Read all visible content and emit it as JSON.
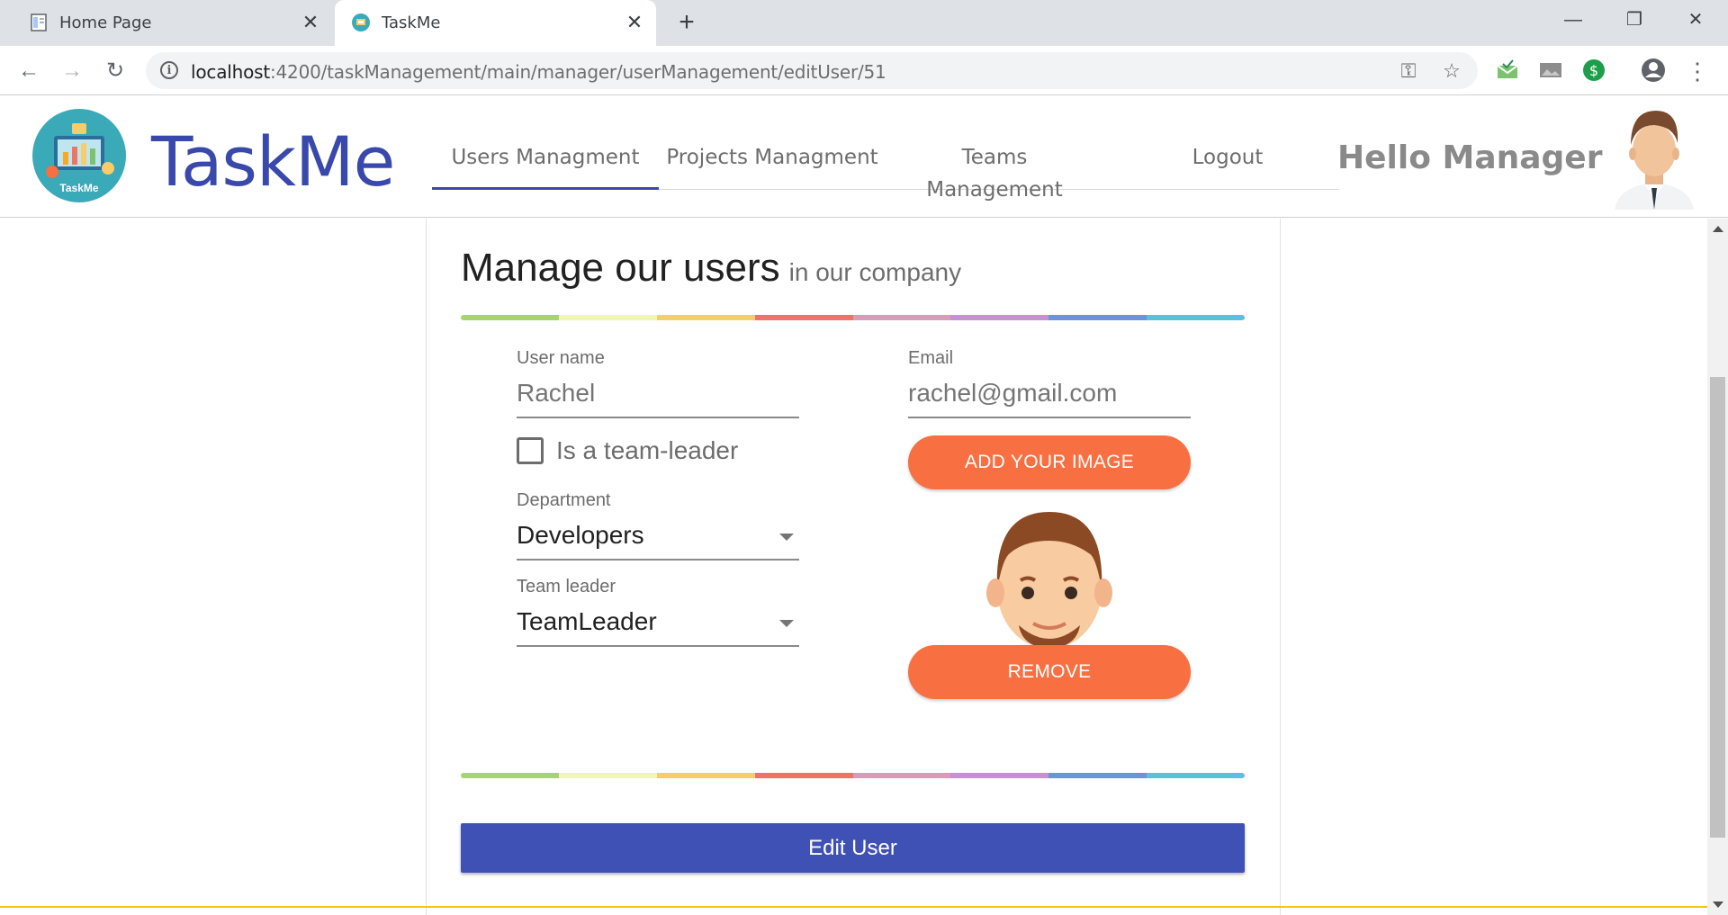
{
  "browser": {
    "tabs": [
      {
        "title": "Home Page",
        "active": false
      },
      {
        "title": "TaskMe",
        "active": true
      }
    ],
    "url_host": "localhost",
    "url_path": ":4200/taskManagement/main/manager/userManagement/editUser/51"
  },
  "header": {
    "brand": "TaskMe",
    "logo_text": "TaskMe",
    "nav": [
      {
        "label": "Users Managment",
        "active": true
      },
      {
        "label": "Projects Managment",
        "active": false
      },
      {
        "label": "Teams Management",
        "active": false
      },
      {
        "label": "Logout",
        "active": false
      }
    ],
    "greeting": "Hello Manager"
  },
  "form": {
    "title": "Manage our users",
    "subtitle": "in our company",
    "username": {
      "label": "User name",
      "value": "Rachel"
    },
    "email": {
      "label": "Email",
      "value": "rachel@gmail.com"
    },
    "team_leader_checkbox": {
      "label": "Is a team-leader",
      "checked": false
    },
    "department": {
      "label": "Department",
      "value": "Developers"
    },
    "team_leader": {
      "label": "Team leader",
      "value": "TeamLeader"
    },
    "add_image_label": "ADD YOUR IMAGE",
    "remove_label": "REMOVE",
    "submit_label": "Edit User"
  },
  "colors": {
    "brand": "#3949ab",
    "accent": "#f86f42",
    "primary_button": "#3f51b5",
    "rainbow": [
      "#a8d46f",
      "#f0f7b0",
      "#f9cc6b",
      "#ee7466",
      "#d99bb8",
      "#c590d4",
      "#6a95dc",
      "#5bc0de"
    ]
  },
  "icons": [
    "info-icon",
    "key-icon",
    "star-icon",
    "reload-icon",
    "back-arrow-icon",
    "forward-arrow-icon",
    "account-icon",
    "menu-dots-icon",
    "dropdown-arrow-icon"
  ]
}
